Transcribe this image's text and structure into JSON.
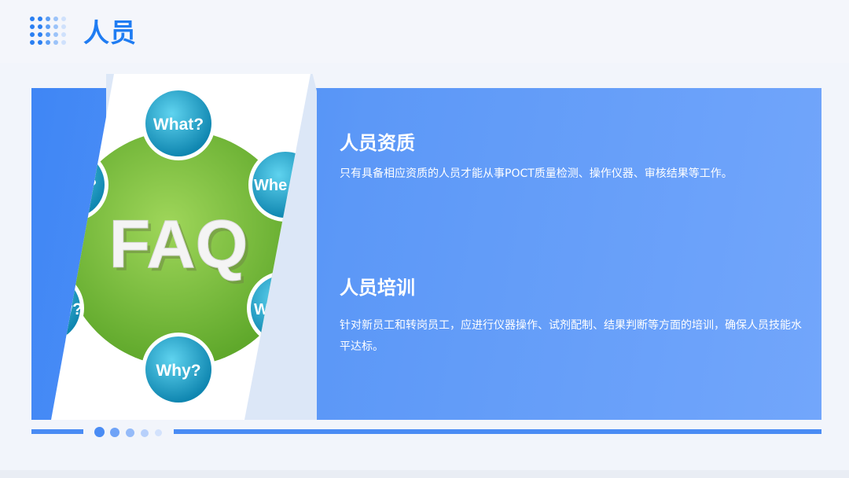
{
  "page": {
    "title": "人员"
  },
  "illustration": {
    "center_text": "FAQ",
    "bubbles": [
      "What?",
      "Whe",
      "?",
      "w?",
      "W",
      "Why?"
    ]
  },
  "sections": [
    {
      "title": "人员资质",
      "body": "只有具备相应资质的人员才能从事POCT质量检测、操作仪器、审核结果等工作。"
    },
    {
      "title": "人员培训",
      "body": "针对新员工和转岗员工，应进行仪器操作、试剂配制、结果判断等方面的培训，确保人员技能水平达标。"
    }
  ],
  "colors": {
    "accent": "#1f7cf2",
    "panel": "#5c98f7",
    "faq_green": "#7bbf3f",
    "bubble_teal": "#1ca6c9"
  }
}
